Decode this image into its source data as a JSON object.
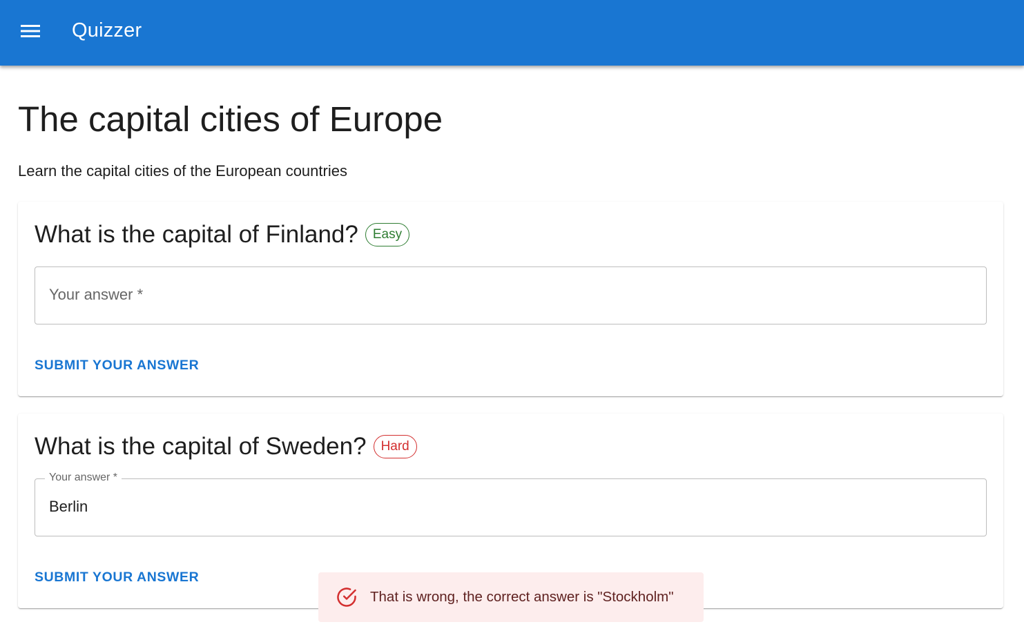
{
  "app": {
    "title": "Quizzer",
    "menu_icon": "menu-icon",
    "brand_color": "#1976d2"
  },
  "page": {
    "title": "The capital cities of Europe",
    "subtitle": "Learn the capital cities of the European countries"
  },
  "questions": [
    {
      "text": "What is the capital of Finland?",
      "difficulty": "Easy",
      "difficulty_color": "#2e7d32",
      "answer_label": "Your answer *",
      "answer_value": "",
      "submit_label": "SUBMIT YOUR ANSWER"
    },
    {
      "text": "What is the capital of Sweden?",
      "difficulty": "Hard",
      "difficulty_color": "#d32f2f",
      "answer_label": "Your answer *",
      "answer_value": "Berlin",
      "submit_label": "SUBMIT YOUR ANSWER"
    }
  ],
  "toast": {
    "icon": "check-circle-icon",
    "message": "That is wrong, the correct answer is \"Stockholm\"",
    "background": "#fdeded",
    "text_color": "#5f2120",
    "icon_color": "#d32f2f"
  }
}
